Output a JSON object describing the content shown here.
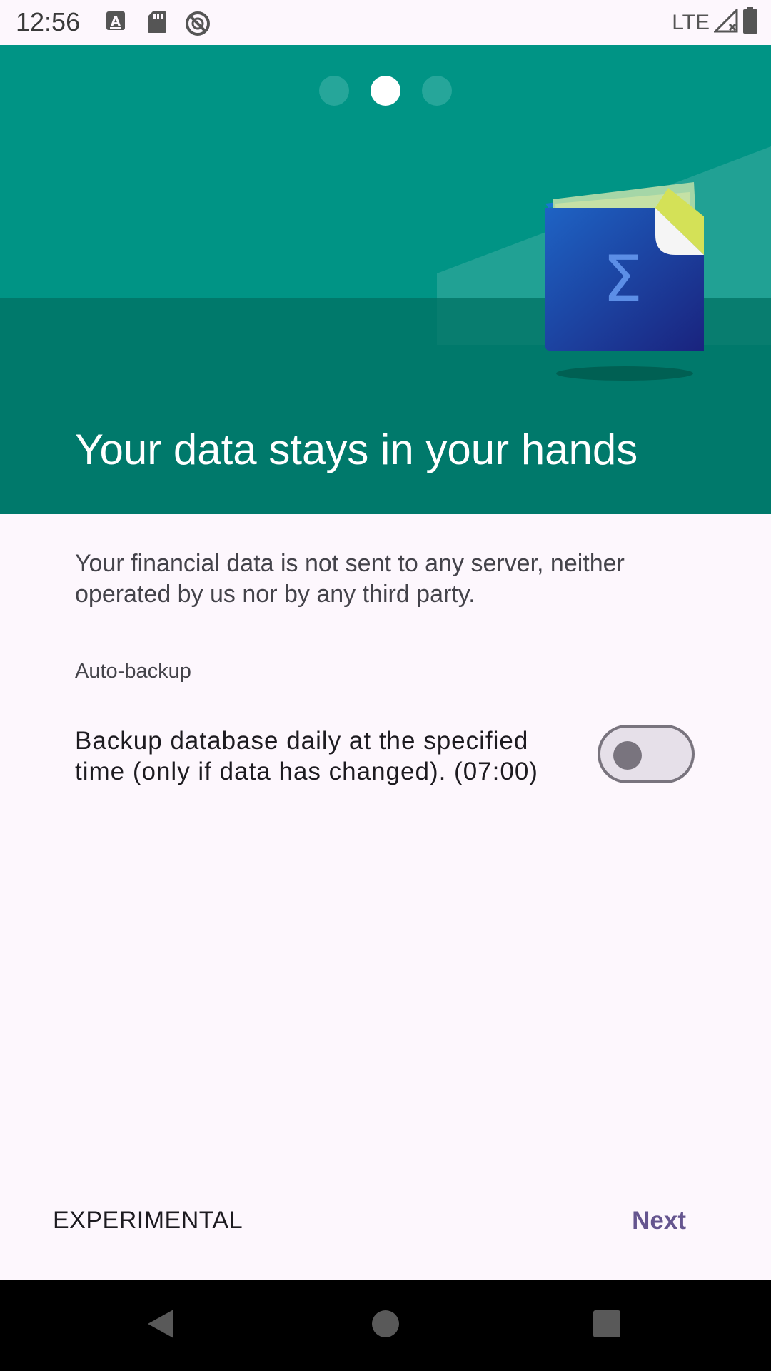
{
  "status_bar": {
    "time": "12:56",
    "network": "LTE",
    "icons": [
      "keyboard-a-icon",
      "sd-card-icon",
      "no-sync-icon",
      "signal-icon",
      "battery-icon"
    ]
  },
  "pager": {
    "page_count": 3,
    "current_page": 2
  },
  "hero": {
    "title": "Your data stays in your hands",
    "illustration": "wallet-sigma-icon",
    "colors": {
      "upper": "#009485",
      "lower": "#00796b"
    }
  },
  "content": {
    "description": "Your financial data is not sent to any server, neither operated by us nor by any third party.",
    "section_label": "Auto-backup",
    "backup_setting": {
      "text": "Backup database daily at the specified time (only if data has changed). (07:00)",
      "enabled": false
    }
  },
  "buttons": {
    "experimental": "EXPERIMENTAL",
    "next": "Next"
  },
  "nav": {
    "icons": [
      "back-icon",
      "home-icon",
      "recents-icon"
    ]
  },
  "colors": {
    "accent": "#65558f",
    "background": "#fdf7fd"
  }
}
